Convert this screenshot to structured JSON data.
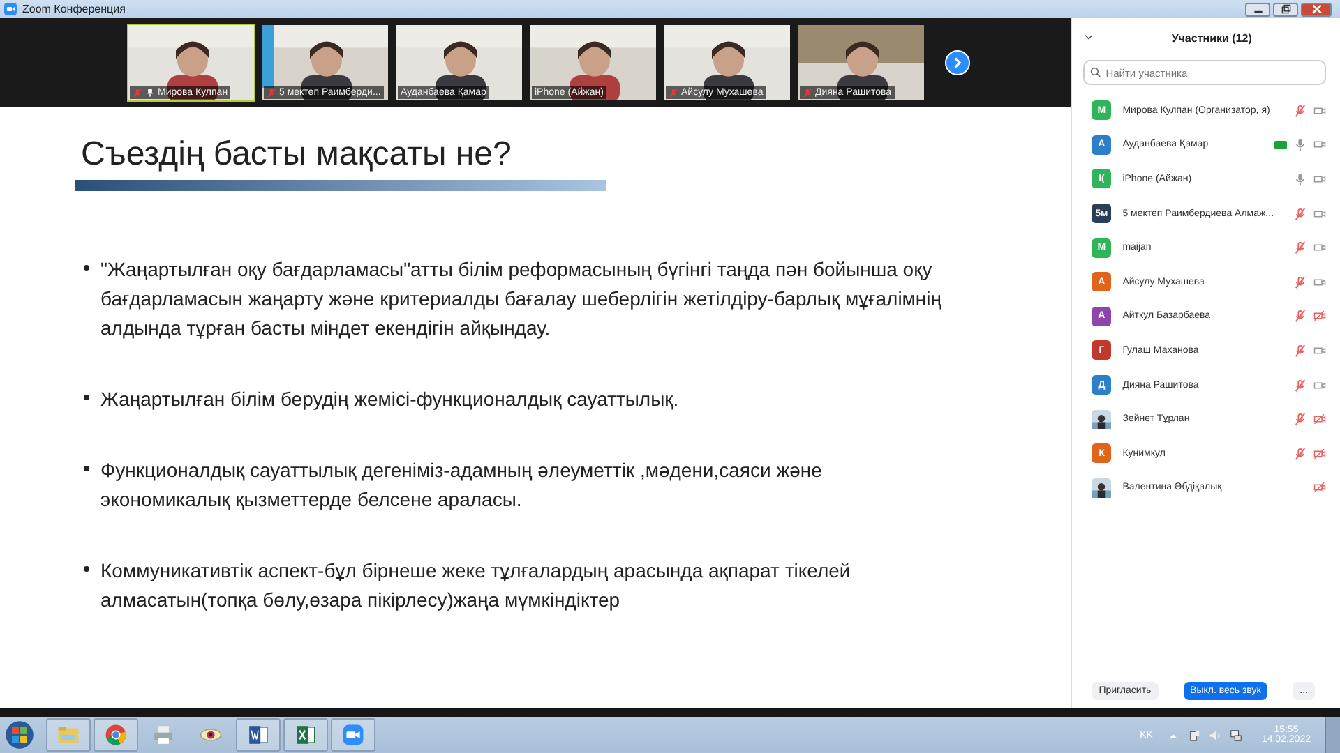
{
  "window": {
    "title": "Zoom Конференция"
  },
  "videos": [
    {
      "name": "Мирова Кулпан",
      "muted": true,
      "pinned": true,
      "selected": true
    },
    {
      "name": "5 мектеп Раимберди...",
      "muted": true,
      "pinned": false,
      "selected": false
    },
    {
      "name": "Ауданбаева Қамар",
      "muted": false,
      "pinned": false,
      "selected": false
    },
    {
      "name": "iPhone (Айжан)",
      "muted": false,
      "pinned": false,
      "selected": false
    },
    {
      "name": "Айсулу Мухашева",
      "muted": true,
      "pinned": false,
      "selected": false
    },
    {
      "name": "Дияна Рашитова",
      "muted": true,
      "pinned": false,
      "selected": false
    }
  ],
  "slide": {
    "title": "Съездің басты мақсаты не?",
    "bullets": [
      "\"Жаңартылған оқу бағдарламасы\"атты білім реформасының бүгінгі таңда пән бойынша оқу бағдарламасын жаңарту және критериалды  бағалау шеберлігін жетілдіру-барлық мұғалімнің алдында тұрған басты міндет екендігін  айқындау.",
      "Жаңартылған  білім берудің жемісі-функционалдық сауаттылық.",
      "Функционалдық сауаттылық  дегеніміз-адамның әлеуметтік ,мәдени,саяси және экономикалық қызметтерде белсене араласы.",
      "Коммуникативтік аспект-бұл бірнеше жеке тұлғалардың арасында ақпарат тікелей алмасатын(топқа бөлу,өзара пікірлесу)жаңа мүмкіндіктер"
    ]
  },
  "participants_panel": {
    "title": "Участники (12)",
    "search": {
      "placeholder": "Найти участника"
    },
    "participants": [
      {
        "name": "Мирова Кулпан (Организатор, я)",
        "avatar": "М",
        "color": "#2fb45a",
        "kind": "letter",
        "audio_connected": true,
        "muted": true,
        "video_off": false,
        "talking": false
      },
      {
        "name": "Ауданбаева Қамар",
        "avatar": "А",
        "color": "#2d7fc8",
        "kind": "letter",
        "audio_connected": true,
        "muted": false,
        "video_off": false,
        "talking": true
      },
      {
        "name": "iPhone (Айжан)",
        "avatar": "I(",
        "color": "#2fb45a",
        "kind": "letter",
        "audio_connected": true,
        "muted": false,
        "video_off": false,
        "talking": false
      },
      {
        "name": "5 мектеп Раимбердиева Алмаж...",
        "avatar": "5м",
        "color": "#2b3e57",
        "kind": "letter",
        "audio_connected": true,
        "muted": true,
        "video_off": false,
        "talking": false
      },
      {
        "name": "maijan",
        "avatar": "M",
        "color": "#2fb45a",
        "kind": "letter",
        "audio_connected": true,
        "muted": true,
        "video_off": false,
        "talking": false
      },
      {
        "name": "Айсулу Мухашева",
        "avatar": "А",
        "color": "#e0641a",
        "kind": "letter",
        "audio_connected": true,
        "muted": true,
        "video_off": false,
        "talking": false
      },
      {
        "name": "Айткул Базарбаева",
        "avatar": "А",
        "color": "#8e44ad",
        "kind": "letter",
        "audio_connected": true,
        "muted": true,
        "video_off": true,
        "talking": false
      },
      {
        "name": "Гулаш Маханова",
        "avatar": "Г",
        "color": "#c0392b",
        "kind": "letter",
        "audio_connected": true,
        "muted": true,
        "video_off": false,
        "talking": false
      },
      {
        "name": "Дияна Рашитова",
        "avatar": "Д",
        "color": "#2d7fc8",
        "kind": "letter",
        "audio_connected": true,
        "muted": true,
        "video_off": false,
        "talking": false
      },
      {
        "name": "Зейнет Тұрлан",
        "kind": "picture",
        "audio_connected": true,
        "muted": true,
        "video_off": true,
        "talking": false
      },
      {
        "name": "Кунимкул",
        "avatar": "К",
        "color": "#e0641a",
        "kind": "letter",
        "audio_connected": true,
        "muted": true,
        "video_off": true,
        "talking": false
      },
      {
        "name": "Валентина Әбдіқалық",
        "kind": "picture",
        "audio_connected": false,
        "video_off": true,
        "talking": false
      }
    ],
    "buttons": [
      {
        "label": "Пригласить",
        "kind": "plain"
      },
      {
        "label": "Выкл. весь звук",
        "kind": "primary"
      },
      {
        "label": "...",
        "kind": "plain"
      }
    ]
  },
  "taskbar": {
    "apps": [
      {
        "kind": "start"
      },
      {
        "kind": "folder"
      },
      {
        "kind": "chrome"
      },
      {
        "kind": "printer"
      },
      {
        "kind": "eye"
      },
      {
        "kind": "word"
      },
      {
        "kind": "excel"
      },
      {
        "kind": "zoom"
      }
    ],
    "language": "KK",
    "time": "15:55",
    "date": "14.02.2022"
  }
}
